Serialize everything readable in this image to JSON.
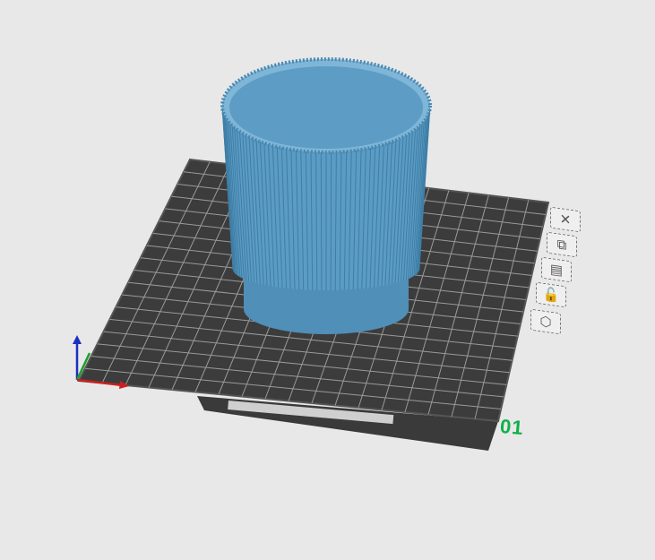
{
  "plate": {
    "number": "01",
    "fill": "#3c3c3c",
    "grid": "#9a9a9a"
  },
  "model": {
    "color": "#5b9cc4",
    "ribs": 64
  },
  "plate_buttons": [
    {
      "name": "delete-plate-button",
      "glyph": "✕"
    },
    {
      "name": "arrange-button",
      "glyph": "⧉"
    },
    {
      "name": "auto-orient-button",
      "glyph": "▤"
    },
    {
      "name": "lock-plate-button",
      "glyph": "🔓"
    },
    {
      "name": "plate-settings-button",
      "glyph": "⬡"
    }
  ]
}
